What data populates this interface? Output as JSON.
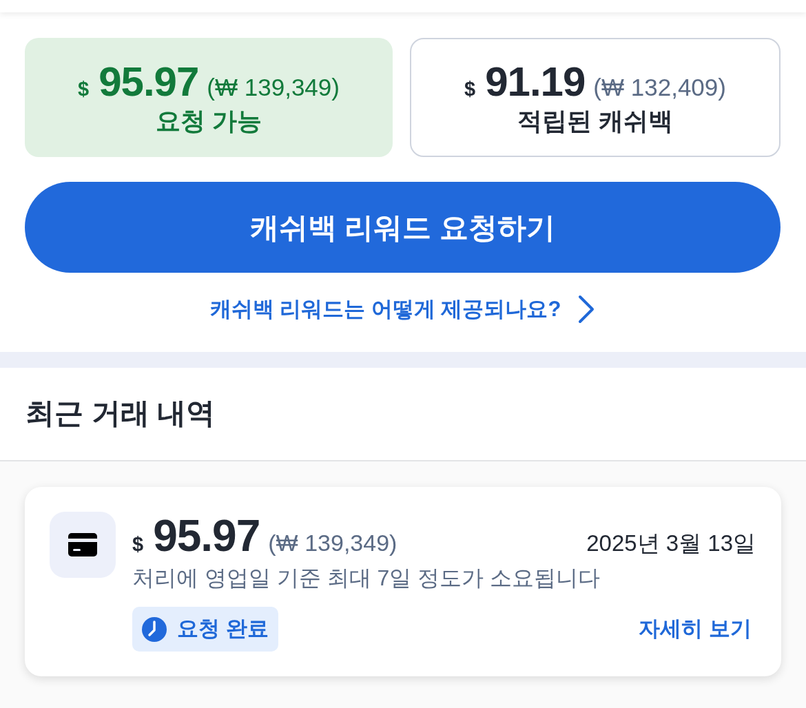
{
  "balances": [
    {
      "kind": "available",
      "currency": "$",
      "amount": "95.97",
      "converted": "(₩ 139,349)",
      "label": "요청 가능"
    },
    {
      "kind": "accrued",
      "currency": "$",
      "amount": "91.19",
      "converted": "(₩ 132,409)",
      "label": "적립된 캐쉬백"
    }
  ],
  "request_button": {
    "label": "캐쉬백 리워드 요청하기"
  },
  "info_link": {
    "label": "캐쉬백 리워드는 어떻게 제공되나요?"
  },
  "recent_transactions": {
    "title": "최근 거래 내역",
    "items": [
      {
        "currency": "$",
        "amount": "95.97",
        "converted": "(₩ 139,349)",
        "date": "2025년 3월 13일",
        "note": "처리에 영업일 기준 최대 7일 정도가 소요됩니다",
        "status": "요청 완료",
        "details_link": "자세히 보기"
      }
    ]
  }
}
